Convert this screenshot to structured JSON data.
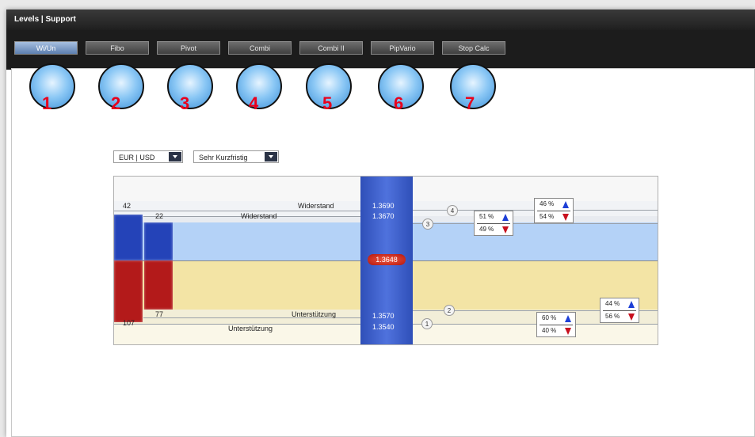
{
  "window": {
    "title": "Levels | Support"
  },
  "tabs": [
    {
      "label": "Wi/Un",
      "active": true
    },
    {
      "label": "Fibo"
    },
    {
      "label": "Pivot"
    },
    {
      "label": "Combi"
    },
    {
      "label": "Combi II"
    },
    {
      "label": "PipVario"
    },
    {
      "label": "Stop Calc"
    }
  ],
  "markers": [
    "1",
    "2",
    "3",
    "4",
    "5",
    "6",
    "7"
  ],
  "controls": {
    "pair": "EUR | USD",
    "horizon": "Sehr Kurzfristig"
  },
  "levels": {
    "res_far": {
      "count": "42",
      "label": "Widerstand",
      "price": "1.3690",
      "circle": "4"
    },
    "res_near": {
      "count": "22",
      "label": "Widerstand",
      "price": "1.3670",
      "circle": "3"
    },
    "current": "1.3648",
    "sup_near": {
      "count": "77",
      "label": "Unterstützung",
      "price": "1.3570",
      "circle": "2"
    },
    "sup_far": {
      "count": "107",
      "label": "Unterstützung",
      "price": "1.3540",
      "circle": "1"
    }
  },
  "probabilities": {
    "res_near": {
      "up": "51 %",
      "down": "49 %"
    },
    "res_far": {
      "up": "46 %",
      "down": "54 %"
    },
    "sup_near": {
      "up": "44 %",
      "down": "56 %"
    },
    "sup_far": {
      "up": "60 %",
      "down": "40 %"
    }
  },
  "colors": {
    "resistance_zone": "#b4d2f7",
    "support_zone": "#f3e4a5",
    "price_column": "#3b5bc8",
    "bar_blue": "#2443b8",
    "bar_red": "#b31a1a",
    "marker_number": "#e8001c"
  }
}
